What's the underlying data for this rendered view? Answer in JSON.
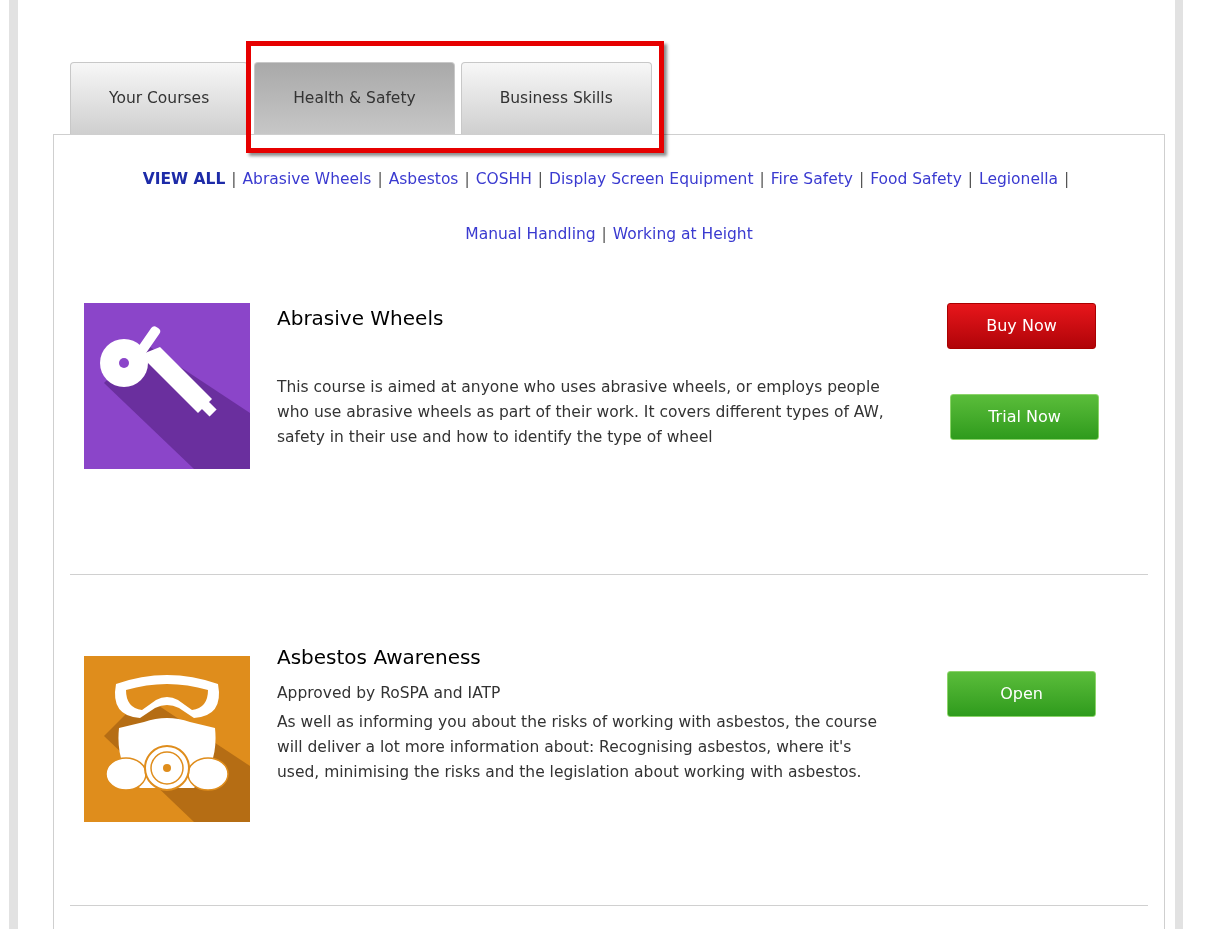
{
  "tabs": [
    {
      "label": "Your Courses",
      "selected": false
    },
    {
      "label": "Health & Safety",
      "selected": true
    },
    {
      "label": "Business Skills",
      "selected": false
    }
  ],
  "highlight": {
    "shown": true
  },
  "filters": {
    "separator": "|",
    "items": [
      {
        "label": "VIEW ALL",
        "selected": true
      },
      {
        "label": "Abrasive Wheels",
        "selected": false
      },
      {
        "label": "Asbestos",
        "selected": false
      },
      {
        "label": "COSHH",
        "selected": false
      },
      {
        "label": "Display Screen Equipment",
        "selected": false
      },
      {
        "label": "Fire Safety",
        "selected": false
      },
      {
        "label": "Food Safety",
        "selected": false
      },
      {
        "label": "Legionella",
        "selected": false
      },
      {
        "label": "Manual Handling",
        "selected": false
      },
      {
        "label": "Working at Height",
        "selected": false
      }
    ]
  },
  "courses": [
    {
      "kind": "grinder",
      "title": "Abrasive Wheels",
      "description": "This course is aimed at anyone who uses abrasive wheels, or employs people who use abrasive wheels as part of their work. It covers different types of AW, safety in their use and how to identify the type of wheel",
      "buttons": [
        {
          "kind": "buy",
          "label": "Buy Now"
        },
        {
          "kind": "trial",
          "label": "Trial Now"
        }
      ]
    },
    {
      "kind": "mask",
      "title": "Asbestos Awareness",
      "approval": "Approved by RoSPA and IATP",
      "description": "As well as informing you about the risks of working with asbestos, the course will deliver a lot more information about: Recognising asbestos, where it's used, minimising the risks and the legislation about working with asbestos.",
      "buttons": [
        {
          "kind": "open",
          "label": "Open"
        }
      ]
    }
  ]
}
